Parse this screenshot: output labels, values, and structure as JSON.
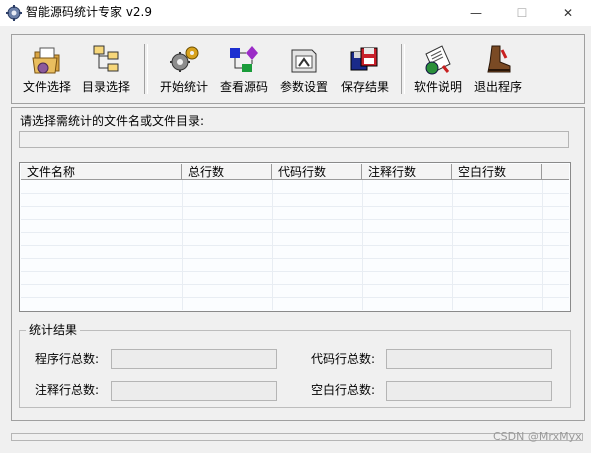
{
  "window": {
    "title": "智能源码统计专家 v2.9",
    "minimize": "—",
    "maximize": "☐",
    "close": "✕"
  },
  "toolbar": {
    "file_select": "文件选择",
    "dir_select": "目录选择",
    "start_stats": "开始统计",
    "view_source": "查看源码",
    "settings": "参数设置",
    "save_results": "保存结果",
    "about": "软件说明",
    "exit": "退出程序"
  },
  "main": {
    "prompt": "请选择需统计的文件名或文件目录:",
    "file_input_value": ""
  },
  "table": {
    "columns": [
      "文件名称",
      "总行数",
      "代码行数",
      "注释行数",
      "空白行数"
    ],
    "rows": []
  },
  "results": {
    "title": "统计结果",
    "program_lines_label": "程序行总数:",
    "code_lines_label": "代码行总数:",
    "comment_lines_label": "注释行总数:",
    "blank_lines_label": "空白行总数:",
    "program_lines_value": "",
    "code_lines_value": "",
    "comment_lines_value": "",
    "blank_lines_value": ""
  },
  "watermark": "CSDN @MrxMyx",
  "colors": {
    "window_bg": "#f0f0f0",
    "table_bg": "#fbfdff",
    "border": "#a0a0a0"
  }
}
